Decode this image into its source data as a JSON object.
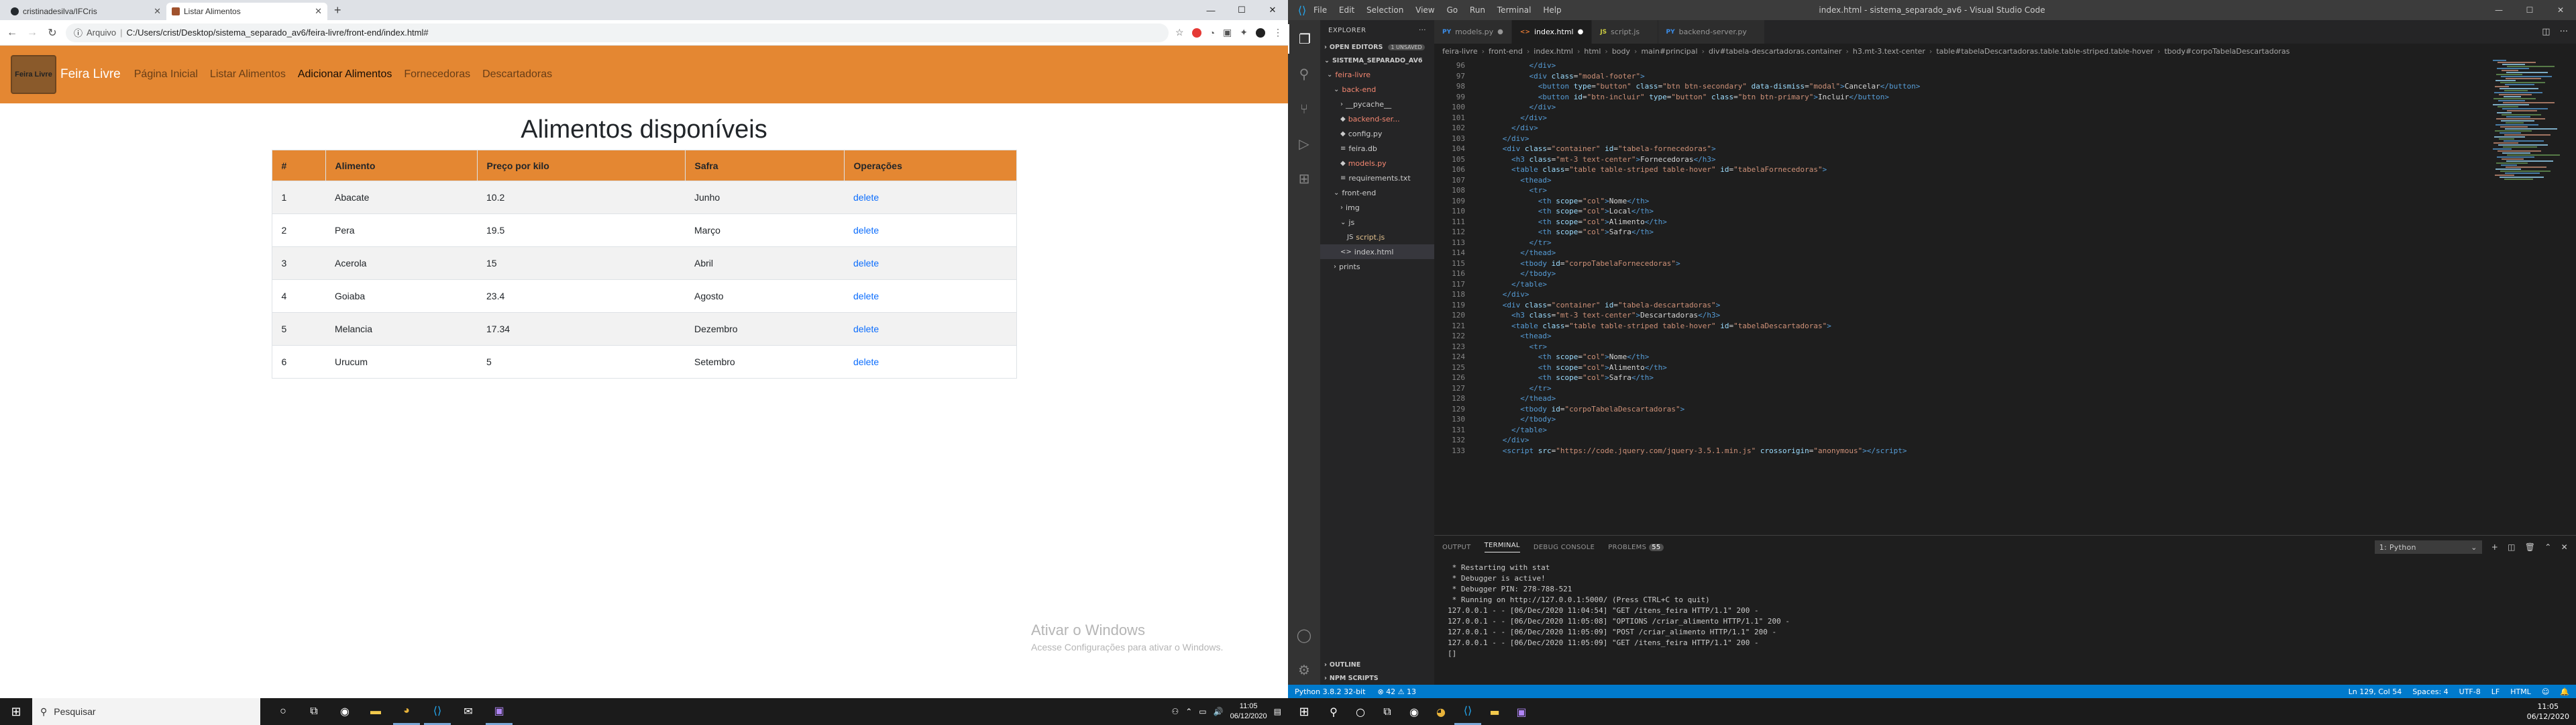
{
  "left": {
    "browser": {
      "tabs": [
        {
          "title": "cristinadesilva/IFCris",
          "active": false
        },
        {
          "title": "Listar Alimentos",
          "active": true
        }
      ],
      "address": {
        "scheme_label": "Arquivo",
        "url": "C:/Users/crist/Desktop/sistema_separado_av6/feira-livre/front-end/index.html#"
      }
    },
    "app": {
      "logo_text": "Feira Livre",
      "brand": "Feira Livre",
      "nav": [
        "Página Inicial",
        "Listar Alimentos",
        "Adicionar Alimentos",
        "Fornecedoras",
        "Descartadoras"
      ],
      "page_title": "Alimentos disponíveis",
      "table": {
        "headers": [
          "#",
          "Alimento",
          "Preço por kilo",
          "Safra",
          "Operações"
        ],
        "rows": [
          {
            "id": "1",
            "name": "Abacate",
            "price": "10.2",
            "season": "Junho",
            "action": "delete"
          },
          {
            "id": "2",
            "name": "Pera",
            "price": "19.5",
            "season": "Março",
            "action": "delete"
          },
          {
            "id": "3",
            "name": "Acerola",
            "price": "15",
            "season": "Abril",
            "action": "delete"
          },
          {
            "id": "4",
            "name": "Goiaba",
            "price": "23.4",
            "season": "Agosto",
            "action": "delete"
          },
          {
            "id": "5",
            "name": "Melancia",
            "price": "17.34",
            "season": "Dezembro",
            "action": "delete"
          },
          {
            "id": "6",
            "name": "Urucum",
            "price": "5",
            "season": "Setembro",
            "action": "delete"
          }
        ]
      }
    },
    "watermark": {
      "title": "Ativar o Windows",
      "subtitle": "Acesse Configurações para ativar o Windows."
    },
    "taskbar": {
      "search_placeholder": "Pesquisar",
      "time": "11:05",
      "date": "06/12/2020"
    }
  },
  "right": {
    "vscode": {
      "window_title": "index.html - sistema_separado_av6 - Visual Studio Code",
      "menu": [
        "File",
        "Edit",
        "Selection",
        "View",
        "Go",
        "Run",
        "Terminal",
        "Help"
      ],
      "explorer": {
        "header": "EXPLORER",
        "open_editors": "OPEN EDITORS",
        "unsaved_badge": "1 UNSAVED",
        "project": "SISTEMA_SEPARADO_AV6",
        "tree": [
          {
            "label": "feira-livre",
            "indent": 0,
            "prefix": "⌄",
            "cls": "c-red"
          },
          {
            "label": "back-end",
            "indent": 1,
            "prefix": "⌄",
            "cls": "c-red"
          },
          {
            "label": "__pycache__",
            "indent": 2,
            "prefix": "›",
            "cls": ""
          },
          {
            "label": "backend-ser...",
            "indent": 2,
            "prefix": "◆",
            "cls": "c-red"
          },
          {
            "label": "config.py",
            "indent": 2,
            "prefix": "◆",
            "cls": ""
          },
          {
            "label": "feira.db",
            "indent": 2,
            "prefix": "≡",
            "cls": ""
          },
          {
            "label": "models.py",
            "indent": 2,
            "prefix": "◆",
            "cls": "c-red"
          },
          {
            "label": "requirements.txt",
            "indent": 2,
            "prefix": "≡",
            "cls": ""
          },
          {
            "label": "front-end",
            "indent": 1,
            "prefix": "⌄",
            "cls": ""
          },
          {
            "label": "img",
            "indent": 2,
            "prefix": "›",
            "cls": ""
          },
          {
            "label": "js",
            "indent": 2,
            "prefix": "⌄",
            "cls": ""
          },
          {
            "label": "script.js",
            "indent": 3,
            "prefix": "JS",
            "cls": "c-yel"
          },
          {
            "label": "index.html",
            "indent": 2,
            "prefix": "<>",
            "cls": "",
            "selected": true
          },
          {
            "label": "prints",
            "indent": 1,
            "prefix": "›",
            "cls": ""
          }
        ],
        "outline": "OUTLINE",
        "npm": "NPM SCRIPTS"
      },
      "tabs": [
        {
          "icon": "PY",
          "label": "models.py",
          "mod": "●",
          "active": false,
          "kind": "py"
        },
        {
          "icon": "<>",
          "label": "index.html",
          "mod": "●",
          "active": true,
          "kind": "html"
        },
        {
          "icon": "JS",
          "label": "script.js",
          "mod": "",
          "active": false,
          "kind": "js"
        },
        {
          "icon": "PY",
          "label": "backend-server.py",
          "mod": "",
          "active": false,
          "kind": "py"
        }
      ],
      "breadcrumbs": [
        "feira-livre",
        "front-end",
        "index.html",
        "html",
        "body",
        "main#principal",
        "div#tabela-descartadoras.container",
        "h3.mt-3.text-center",
        "table#tabelaDescartadoras.table.table-striped.table-hover",
        "tbody#corpoTabelaDescartadoras"
      ],
      "code_lines": [
        {
          "n": "96",
          "html": "            <span class='tg'>&lt;/div&gt;</span>"
        },
        {
          "n": "97",
          "html": "            <span class='tg'>&lt;div</span> <span class='at'>class</span>=<span class='sv'>\"modal-footer\"</span><span class='tg'>&gt;</span>"
        },
        {
          "n": "98",
          "html": "              <span class='tg'>&lt;button</span> <span class='at'>type</span>=<span class='sv'>\"button\"</span> <span class='at'>class</span>=<span class='sv'>\"btn btn-secondary\"</span> <span class='at'>data-dismiss</span>=<span class='sv'>\"modal\"</span><span class='tg'>&gt;</span>Cancelar<span class='tg'>&lt;/button&gt;</span>"
        },
        {
          "n": "99",
          "html": "              <span class='tg'>&lt;button</span> <span class='at'>id</span>=<span class='sv'>\"btn-incluir\"</span> <span class='at'>type</span>=<span class='sv'>\"button\"</span> <span class='at'>class</span>=<span class='sv'>\"btn btn-primary\"</span><span class='tg'>&gt;</span>Incluir<span class='tg'>&lt;/button&gt;</span>"
        },
        {
          "n": "100",
          "html": "            <span class='tg'>&lt;/div&gt;</span>"
        },
        {
          "n": "101",
          "html": "          <span class='tg'>&lt;/div&gt;</span>"
        },
        {
          "n": "102",
          "html": "        <span class='tg'>&lt;/div&gt;</span>"
        },
        {
          "n": "103",
          "html": "      <span class='tg'>&lt;/div&gt;</span>"
        },
        {
          "n": "104",
          "html": "      <span class='tg'>&lt;div</span> <span class='at'>class</span>=<span class='sv'>\"container\"</span> <span class='at'>id</span>=<span class='sv'>\"tabela-fornecedoras\"</span><span class='tg'>&gt;</span>"
        },
        {
          "n": "105",
          "html": "        <span class='tg'>&lt;h3</span> <span class='at'>class</span>=<span class='sv'>\"mt-3 text-center\"</span><span class='tg'>&gt;</span>Fornecedoras<span class='tg'>&lt;/h3&gt;</span>"
        },
        {
          "n": "106",
          "html": "        <span class='tg'>&lt;table</span> <span class='at'>class</span>=<span class='sv'>\"table table-striped table-hover\"</span> <span class='at'>id</span>=<span class='sv'>\"tabelaFornecedoras\"</span><span class='tg'>&gt;</span>"
        },
        {
          "n": "107",
          "html": "          <span class='tg'>&lt;thead&gt;</span>"
        },
        {
          "n": "108",
          "html": "            <span class='tg'>&lt;tr&gt;</span>"
        },
        {
          "n": "109",
          "html": "              <span class='tg'>&lt;th</span> <span class='at'>scope</span>=<span class='sv'>\"col\"</span><span class='tg'>&gt;</span>Nome<span class='tg'>&lt;/th&gt;</span>"
        },
        {
          "n": "110",
          "html": "              <span class='tg'>&lt;th</span> <span class='at'>scope</span>=<span class='sv'>\"col\"</span><span class='tg'>&gt;</span>Local<span class='tg'>&lt;/th&gt;</span>"
        },
        {
          "n": "111",
          "html": "              <span class='tg'>&lt;th</span> <span class='at'>scope</span>=<span class='sv'>\"col\"</span><span class='tg'>&gt;</span>Alimento<span class='tg'>&lt;/th&gt;</span>"
        },
        {
          "n": "112",
          "html": "              <span class='tg'>&lt;th</span> <span class='at'>scope</span>=<span class='sv'>\"col\"</span><span class='tg'>&gt;</span>Safra<span class='tg'>&lt;/th&gt;</span>"
        },
        {
          "n": "113",
          "html": "            <span class='tg'>&lt;/tr&gt;</span>"
        },
        {
          "n": "114",
          "html": "          <span class='tg'>&lt;/thead&gt;</span>"
        },
        {
          "n": "115",
          "html": "          <span class='tg'>&lt;tbody</span> <span class='at'>id</span>=<span class='sv'>\"corpoTabelaFornecedoras\"</span><span class='tg'>&gt;</span>"
        },
        {
          "n": "116",
          "html": "          <span class='tg'>&lt;/tbody&gt;</span>"
        },
        {
          "n": "117",
          "html": "        <span class='tg'>&lt;/table&gt;</span>"
        },
        {
          "n": "118",
          "html": "      <span class='tg'>&lt;/div&gt;</span>"
        },
        {
          "n": "119",
          "html": "      <span class='tg'>&lt;div</span> <span class='at'>class</span>=<span class='sv'>\"container\"</span> <span class='at'>id</span>=<span class='sv'>\"tabela-descartadoras\"</span><span class='tg'>&gt;</span>"
        },
        {
          "n": "120",
          "html": "        <span class='tg'>&lt;h3</span> <span class='at'>class</span>=<span class='sv'>\"mt-3 text-center\"</span><span class='tg'>&gt;</span>Descartadoras<span class='tg'>&lt;/h3&gt;</span>"
        },
        {
          "n": "121",
          "html": "        <span class='tg'>&lt;table</span> <span class='at'>class</span>=<span class='sv'>\"table table-striped table-hover\"</span> <span class='at'>id</span>=<span class='sv'>\"tabelaDescartadoras\"</span><span class='tg'>&gt;</span>"
        },
        {
          "n": "122",
          "html": "          <span class='tg'>&lt;thead&gt;</span>"
        },
        {
          "n": "123",
          "html": "            <span class='tg'>&lt;tr&gt;</span>"
        },
        {
          "n": "124",
          "html": "              <span class='tg'>&lt;th</span> <span class='at'>scope</span>=<span class='sv'>\"col\"</span><span class='tg'>&gt;</span>Nome<span class='tg'>&lt;/th&gt;</span>"
        },
        {
          "n": "125",
          "html": "              <span class='tg'>&lt;th</span> <span class='at'>scope</span>=<span class='sv'>\"col\"</span><span class='tg'>&gt;</span>Alimento<span class='tg'>&lt;/th&gt;</span>"
        },
        {
          "n": "126",
          "html": "              <span class='tg'>&lt;th</span> <span class='at'>scope</span>=<span class='sv'>\"col\"</span><span class='tg'>&gt;</span>Safra<span class='tg'>&lt;/th&gt;</span>"
        },
        {
          "n": "127",
          "html": "            <span class='tg'>&lt;/tr&gt;</span>"
        },
        {
          "n": "128",
          "html": "          <span class='tg'>&lt;/thead&gt;</span>"
        },
        {
          "n": "129",
          "html": "          <span class='tg'>&lt;tbody</span> <span class='at'>id</span>=<span class='sv'>\"corpoTabelaDescartadoras\"</span><span class='tg'>&gt;</span>"
        },
        {
          "n": "130",
          "html": "          <span class='tg'>&lt;/tbody&gt;</span>"
        },
        {
          "n": "131",
          "html": "        <span class='tg'>&lt;/table&gt;</span>"
        },
        {
          "n": "132",
          "html": "      <span class='tg'>&lt;/div&gt;</span>"
        },
        {
          "n": "133",
          "html": "      <span class='tg'>&lt;script</span> <span class='at'>src</span>=<span class='sv'>\"https://code.jquery.com/jquery-3.5.1.min.js\"</span> <span class='at'>crossorigin</span>=<span class='sv'>\"anonymous\"</span><span class='tg'>&gt;&lt;/script&gt;</span>"
        }
      ],
      "panel": {
        "tabs": [
          "OUTPUT",
          "TERMINAL",
          "DEBUG CONSOLE",
          "PROBLEMS"
        ],
        "problems_count": "55",
        "shell": "1: Python",
        "terminal_lines": [
          " * Restarting with stat",
          " * Debugger is active!",
          " * Debugger PIN: 278-788-521",
          " * Running on http://127.0.0.1:5000/ (Press CTRL+C to quit)",
          "127.0.0.1 - - [06/Dec/2020 11:04:54] \"GET /itens_feira HTTP/1.1\" 200 -",
          "127.0.0.1 - - [06/Dec/2020 11:05:08] \"OPTIONS /criar_alimento HTTP/1.1\" 200 -",
          "127.0.0.1 - - [06/Dec/2020 11:05:09] \"POST /criar_alimento HTTP/1.1\" 200 -",
          "127.0.0.1 - - [06/Dec/2020 11:05:09] \"GET /itens_feira HTTP/1.1\" 200 -",
          "[]"
        ]
      },
      "status": {
        "python": "Python 3.8.2 32-bit",
        "problems": "⊗ 42  ⚠ 13",
        "position": "Ln 129, Col 54",
        "spaces": "Spaces: 4",
        "encoding": "UTF-8",
        "eol": "LF",
        "language": "HTML"
      }
    },
    "taskbar": {
      "time": "11:05",
      "date": "06/12/2020"
    }
  }
}
